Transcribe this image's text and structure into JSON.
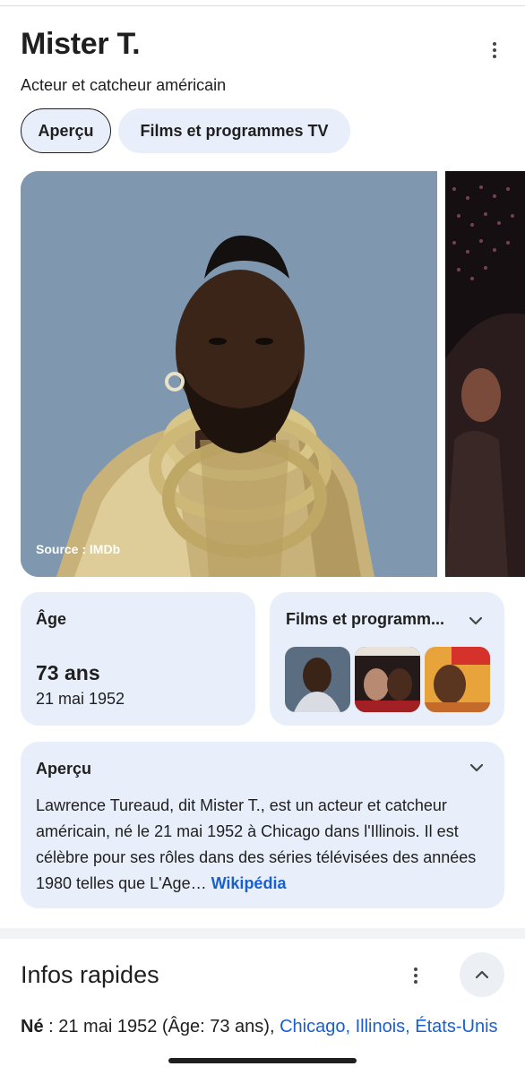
{
  "entity": {
    "title": "Mister T.",
    "subtitle": "Acteur et catcheur américain"
  },
  "tabs": [
    {
      "label": "Aperçu",
      "active": true
    },
    {
      "label": "Films et programmes TV",
      "active": false
    }
  ],
  "image": {
    "source": "Source : IMDb"
  },
  "age_card": {
    "label": "Âge",
    "value": "73 ans",
    "date": "21 mai 1952"
  },
  "films_card": {
    "label": "Films et programm..."
  },
  "overview": {
    "label": "Aperçu",
    "text": "Lawrence Tureaud, dit Mister T., est un acteur et catcheur américain, né le 21 mai 1952 à Chicago dans l'Illinois. Il est célèbre pour ses rôles dans des séries télévisées des années 1980 telles que L'Age",
    "ellipsis": "… ",
    "link": "Wikipédia"
  },
  "quick_facts": {
    "title": "Infos rapides",
    "born_label": "Né",
    "born_separator": " : ",
    "born_value": "21 mai 1952 (Âge: 73 ans), ",
    "born_place": "Chicago, Illinois, États-Unis"
  },
  "colors": {
    "accent": "#1a5fd0",
    "card_bg": "#e8effb",
    "text": "#1f1f1f"
  }
}
